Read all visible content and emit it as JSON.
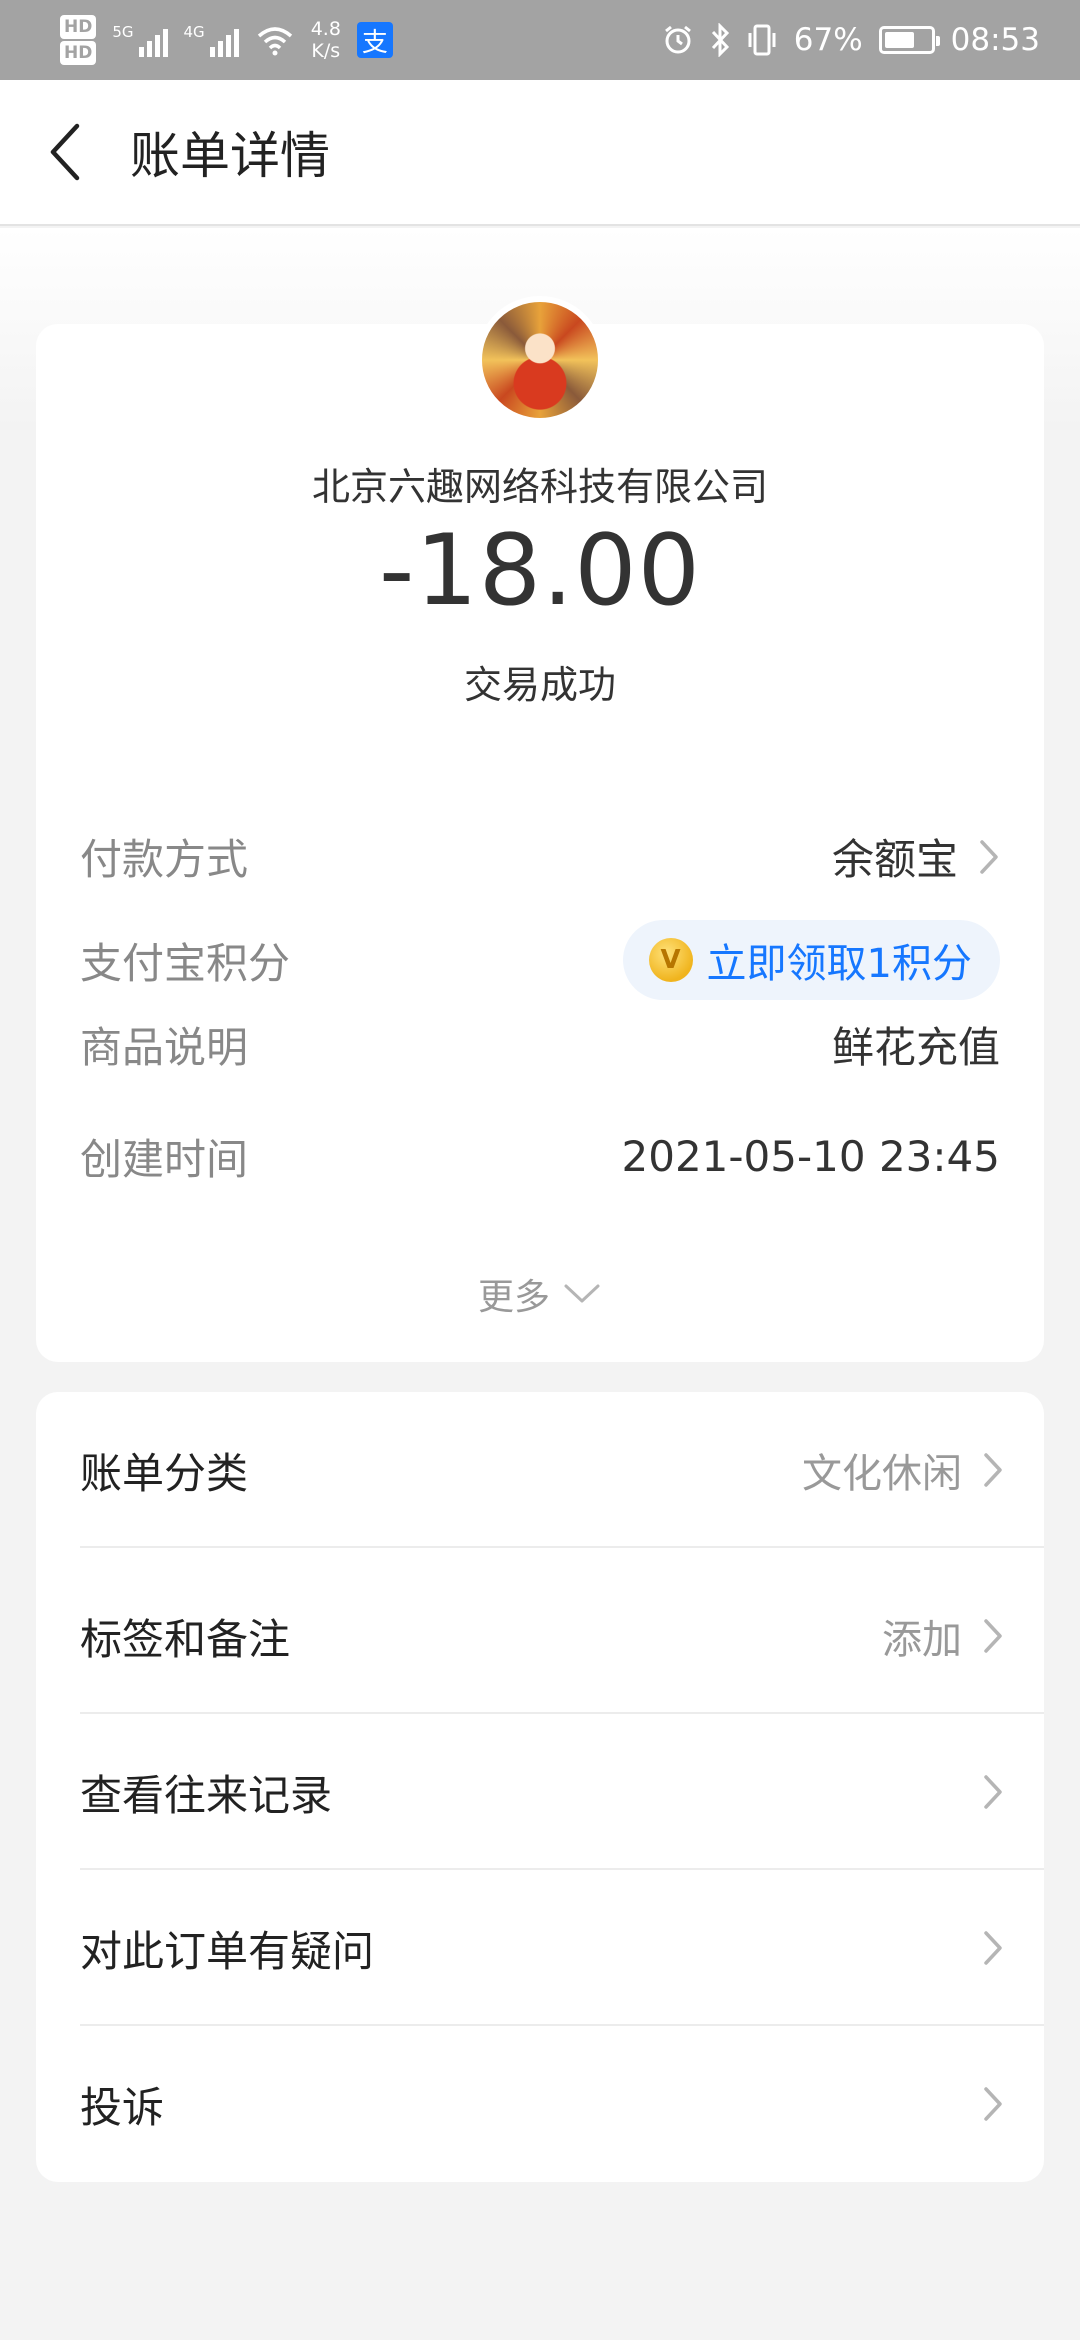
{
  "status_bar": {
    "hd1": "HD",
    "hd2": "HD",
    "signal1_label": "5G",
    "signal2_label": "4G",
    "net_speed_value": "4.8",
    "net_speed_unit": "K/s",
    "alipay_glyph": "支",
    "battery_percent": "67%",
    "battery_level": 0.67,
    "time": "08:53",
    "icons": [
      "alarm-icon",
      "bluetooth-icon",
      "vibrate-icon",
      "battery-icon",
      "wifi-icon",
      "signal-icon"
    ]
  },
  "header": {
    "title": "账单详情",
    "back_icon": "chevron-left-icon"
  },
  "summary": {
    "merchant": "北京六趣网络科技有限公司",
    "amount": "-18.00",
    "status": "交易成功",
    "rows": [
      {
        "label": "付款方式",
        "value": "余额宝"
      },
      {
        "label": "支付宝积分",
        "value": "立即领取1积分",
        "coin_glyph": "V"
      },
      {
        "label": "商品说明",
        "value": "鲜花充值"
      },
      {
        "label": "创建时间",
        "value": "2021-05-10 23:45"
      }
    ],
    "more_label": "更多"
  },
  "actions": [
    {
      "label": "账单分类",
      "value": "文化休闲"
    },
    {
      "label": "标签和备注",
      "value": "添加"
    },
    {
      "label": "查看往来记录",
      "value": ""
    },
    {
      "label": "对此订单有疑问",
      "value": ""
    },
    {
      "label": "投诉",
      "value": ""
    }
  ],
  "colors": {
    "accent": "#1677ff",
    "status_bar": "#a3a3a3",
    "background": "#f3f3f3"
  }
}
